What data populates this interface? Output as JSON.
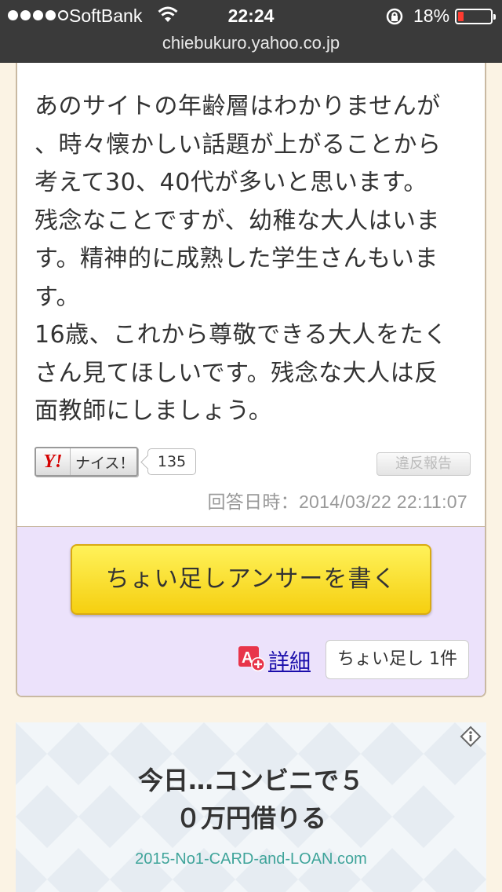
{
  "status_bar": {
    "carrier": "SoftBank",
    "time": "22:24",
    "battery_percent": "18%",
    "battery_level": 0.18,
    "signal_bars_filled": 4
  },
  "browser": {
    "url": "chiebukuro.yahoo.co.jp"
  },
  "answer": {
    "lines": [
      "あのサイトの年齢層はわかりませんが",
      "、時々懐かしい話題が上がることから",
      "考えて30、40代が多いと思います。",
      "残念なことですが、幼稚な大人はいま",
      "す。精神的に成熟した学生さんもいま",
      "す。",
      "16歳、これから尊敬できる大人をたく",
      "さん見てほしいです。残念な大人は反",
      "面教師にしましょう。"
    ],
    "nice_logo": "Y!",
    "nice_label": "ナイス！",
    "nice_count": "135",
    "report_label": "違反報告",
    "date": "回答日時：2014/03/22 22:11:07"
  },
  "supplement": {
    "write_button": "ちょい足しアンサーを書く",
    "detail_link": "詳細",
    "count_label": "ちょい足し 1件"
  },
  "ad": {
    "title_lines": [
      "今日…コンビニで５",
      "０万円借りる"
    ],
    "url": "2015-No1-CARD-and-LOAN.com"
  },
  "colors": {
    "page_background": "#fbf3e4",
    "status_bar": "#3a3a3a",
    "purple_panel": "#ece2fb",
    "button_yellow": "#f5cf10",
    "link_blue": "#1a0dab",
    "ad_url": "#3fa49a",
    "battery_low": "#ff3b30"
  },
  "icons": [
    "wifi-icon",
    "rotation-lock-icon",
    "battery-icon",
    "yahoo-logo",
    "detail-plus-icon",
    "ad-info-icon"
  ]
}
